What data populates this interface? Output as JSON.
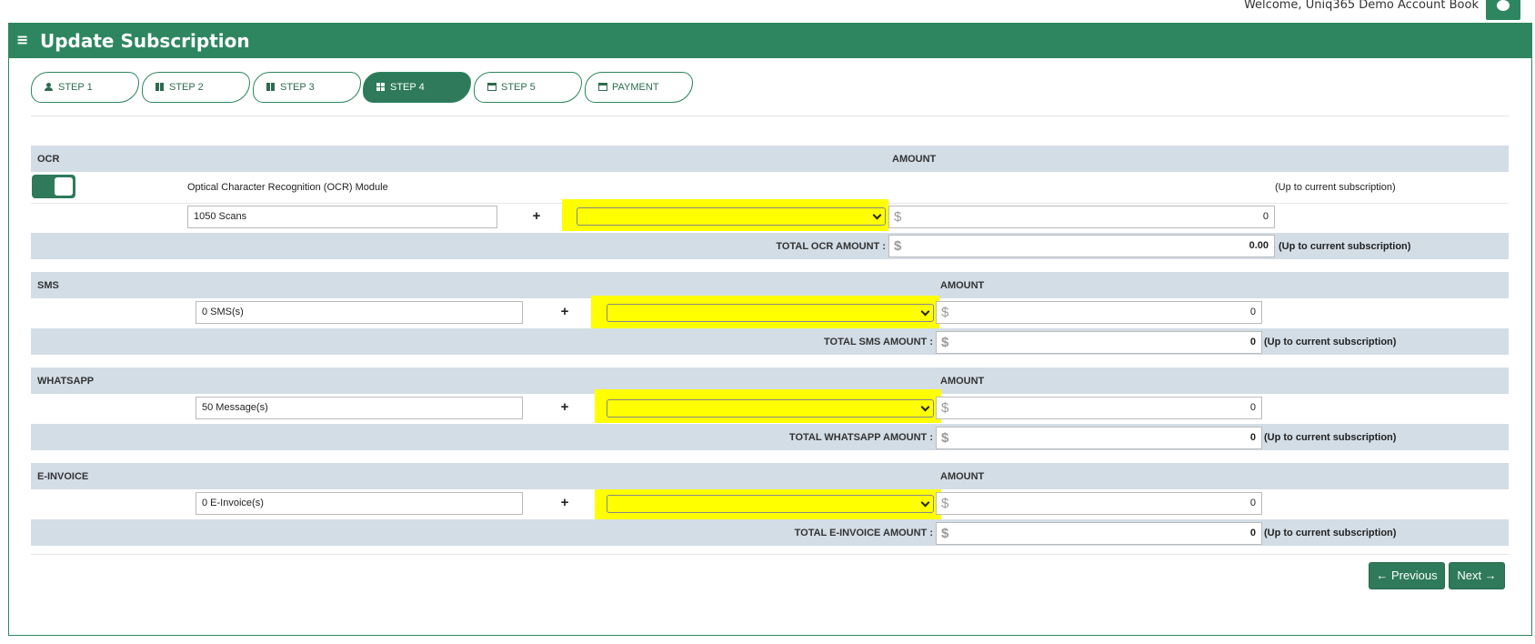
{
  "header": {
    "welcome": "Welcome, Uniq365 Demo Account Book",
    "title": "Update Subscription",
    "menu_icon": "hamburger-menu-icon",
    "user_icon": "user-avatar-icon"
  },
  "steps": [
    {
      "label": "STEP 1",
      "icon": "user-icon",
      "active": false
    },
    {
      "label": "STEP 2",
      "icon": "grid-icon",
      "active": false
    },
    {
      "label": "STEP 3",
      "icon": "grid-icon",
      "active": false
    },
    {
      "label": "STEP 4",
      "icon": "grid-icon",
      "active": true
    },
    {
      "label": "STEP 5",
      "icon": "card-icon",
      "active": false
    },
    {
      "label": "PAYMENT",
      "icon": "card-icon",
      "active": false
    }
  ],
  "ocr": {
    "section": "OCR",
    "amount_header": "AMOUNT",
    "enabled": true,
    "module_label": "Optical Character Recognition (OCR) Module",
    "module_note": "(Up to current subscription)",
    "quantity": "1050 Scans",
    "plus": "+",
    "select_value": "",
    "currency": "$",
    "amount": "0",
    "total_label": "TOTAL OCR AMOUNT :",
    "total": "0.00",
    "total_note": "(Up to current subscription)"
  },
  "sms": {
    "section": "SMS",
    "amount_header": "AMOUNT",
    "quantity": "0 SMS(s)",
    "plus": "+",
    "select_value": "",
    "currency": "$",
    "amount": "0",
    "total_label": "TOTAL SMS AMOUNT :",
    "total": "0",
    "total_note": "(Up to current subscription)"
  },
  "whatsapp": {
    "section": "WHATSAPP",
    "amount_header": "AMOUNT",
    "quantity": "50 Message(s)",
    "plus": "+",
    "select_value": "",
    "currency": "$",
    "amount": "0",
    "total_label": "TOTAL WHATSAPP AMOUNT :",
    "total": "0",
    "total_note": "(Up to current subscription)"
  },
  "einvoice": {
    "section": "E-INVOICE",
    "amount_header": "AMOUNT",
    "quantity": "0 E-Invoice(s)",
    "plus": "+",
    "select_value": "",
    "currency": "$",
    "amount": "0",
    "total_label": "TOTAL E-INVOICE AMOUNT :",
    "total": "0",
    "total_note": "(Up to current subscription)"
  },
  "buttons": {
    "previous": "← Previous",
    "next": "Next →"
  },
  "colors": {
    "brand_green": "#2e8660",
    "band": "#d3dde6",
    "highlight": "#ffff00"
  }
}
